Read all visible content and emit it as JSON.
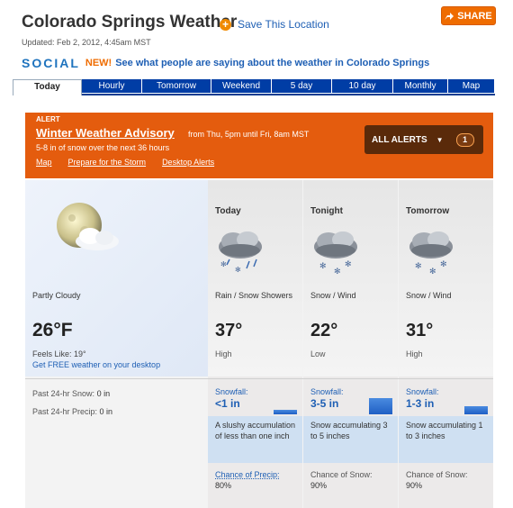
{
  "header": {
    "title": "Colorado Springs Weather",
    "save_label": "Save This Location",
    "share_label": "SHARE",
    "updated": "Updated: Feb 2, 2012, 4:45am MST"
  },
  "social": {
    "logo_text": "SOCIAL",
    "new_label": "NEW!",
    "link_text": "See what people are saying about the weather in Colorado Springs"
  },
  "tabs": [
    {
      "label": "Today",
      "active": true
    },
    {
      "label": "Hourly"
    },
    {
      "label": "Tomorrow"
    },
    {
      "label": "Weekend"
    },
    {
      "label": "5 day"
    },
    {
      "label": "10 day"
    },
    {
      "label": "Monthly"
    },
    {
      "label": "Map"
    }
  ],
  "alert": {
    "tag": "ALERT",
    "title": "Winter Weather Advisory",
    "time": "from Thu, 5pm until Fri, 8am MST",
    "subtitle": "5-8 in of snow over the next 36 hours",
    "links": [
      "Map",
      "Prepare for the Storm",
      "Desktop Alerts"
    ],
    "all_alerts_label": "ALL ALERTS",
    "all_alerts_count": "1"
  },
  "current": {
    "condition": "Partly Cloudy",
    "temp": "26°F",
    "feels_like": "Feels Like: 19°",
    "desktop_link": "Get FREE weather on your desktop",
    "past_snow_label": "Past 24-hr Snow:",
    "past_snow_value": "0 in",
    "past_precip_label": "Past 24-hr Precip:",
    "past_precip_value": "0 in"
  },
  "forecast": [
    {
      "day": "Today",
      "condition": "Rain / Snow Showers",
      "temp": "37°",
      "hl": "High",
      "snow_label": "Snowfall:",
      "snow_value": "<1 in",
      "snow_level": 0.2,
      "snow_desc": "A slushy accumulation of less than one inch",
      "precip_label": "Chance of Precip:",
      "precip_value": "80%"
    },
    {
      "day": "Tonight",
      "condition": "Snow / Wind",
      "temp": "22°",
      "hl": "Low",
      "snow_label": "Snowfall:",
      "snow_value": "3-5 in",
      "snow_level": 0.7,
      "snow_desc": "Snow accumulating 3 to 5 inches",
      "precip_label": "Chance of Snow:",
      "precip_value": "90%"
    },
    {
      "day": "Tomorrow",
      "condition": "Snow / Wind",
      "temp": "31°",
      "hl": "High",
      "snow_label": "Snowfall:",
      "snow_value": "1-3 in",
      "snow_level": 0.35,
      "snow_desc": "Snow accumulating 1 to 3 inches",
      "precip_label": "Chance of Snow:",
      "precip_value": "90%"
    }
  ],
  "colors": {
    "accent": "#e45c0e",
    "tab_blue": "#003da5",
    "link": "#1e5fb4"
  }
}
